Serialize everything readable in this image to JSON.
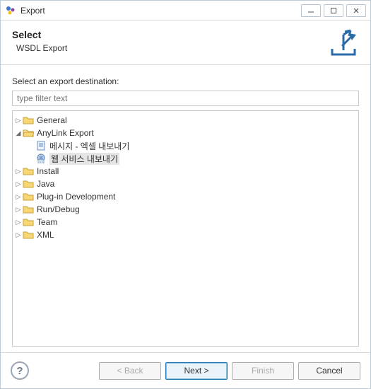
{
  "window": {
    "title": "Export"
  },
  "banner": {
    "heading": "Select",
    "subtitle": "WSDL Export"
  },
  "content": {
    "destination_label": "Select an export destination:",
    "filter_placeholder": "type filter text"
  },
  "tree": {
    "general": "General",
    "anylink_export": "AnyLink Export",
    "anylink_children": {
      "msg_excel": "메시지 - 엑셀 내보내기",
      "web_service": "웹 서비스 내보내기"
    },
    "install": "Install",
    "java": "Java",
    "plugin_dev": "Plug-in Development",
    "run_debug": "Run/Debug",
    "team": "Team",
    "xml": "XML"
  },
  "buttons": {
    "back": "< Back",
    "next": "Next >",
    "finish": "Finish",
    "cancel": "Cancel",
    "help": "?"
  }
}
